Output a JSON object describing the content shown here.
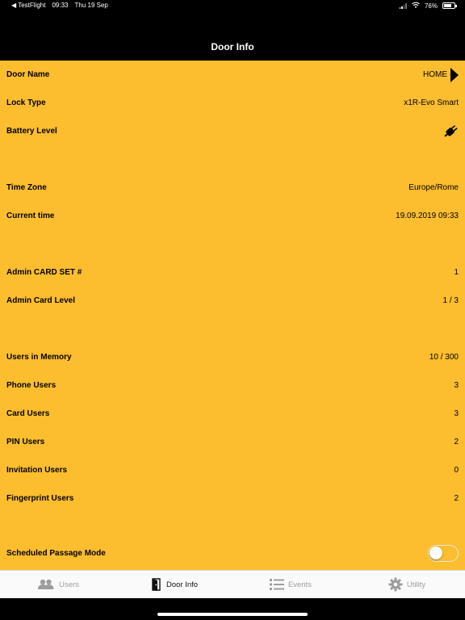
{
  "status": {
    "back_app": "◀ TestFlight",
    "time": "09:33",
    "date": "Thu 19 Sep",
    "wifi_icon": "wifi-icon",
    "battery_percent": "76%",
    "battery_level": 0.76
  },
  "header": {
    "title": "Door Info"
  },
  "info": {
    "door_name": {
      "label": "Door Name",
      "value": "HOME",
      "icon": "triangle-right-icon"
    },
    "lock_type": {
      "label": "Lock Type",
      "value": "x1R-Evo Smart"
    },
    "battery_level": {
      "label": "Battery Level",
      "icon": "plug-icon"
    },
    "time_zone": {
      "label": "Time Zone",
      "value": "Europe/Rome"
    },
    "current_time": {
      "label": "Current time",
      "value": "19.09.2019 09:33"
    },
    "admin_card_set": {
      "label": "Admin CARD SET #",
      "value": "1"
    },
    "admin_card_level": {
      "label": "Admin Card Level",
      "value": "1 / 3"
    },
    "users_in_memory": {
      "label": "Users in Memory",
      "value": "10 / 300"
    },
    "phone_users": {
      "label": "Phone Users",
      "value": "3"
    },
    "card_users": {
      "label": "Card Users",
      "value": "3"
    },
    "pin_users": {
      "label": "PIN Users",
      "value": "2"
    },
    "invitation_users": {
      "label": "Invitation Users",
      "value": "0"
    },
    "fingerprint_users": {
      "label": "Fingerprint Users",
      "value": "2"
    },
    "scheduled_passage_mode": {
      "label": "Scheduled Passage Mode",
      "enabled": false
    }
  },
  "tabs": [
    {
      "label": "Users",
      "icon": "users-icon",
      "active": false
    },
    {
      "label": "Door Info",
      "icon": "door-icon",
      "active": true
    },
    {
      "label": "Events",
      "icon": "list-icon",
      "active": false
    },
    {
      "label": "Utility",
      "icon": "gear-icon",
      "active": false
    }
  ],
  "colors": {
    "background": "#fcbd2e",
    "nav": "#000000",
    "tab_active": "#111111",
    "tab_inactive": "#9d9d9d"
  }
}
